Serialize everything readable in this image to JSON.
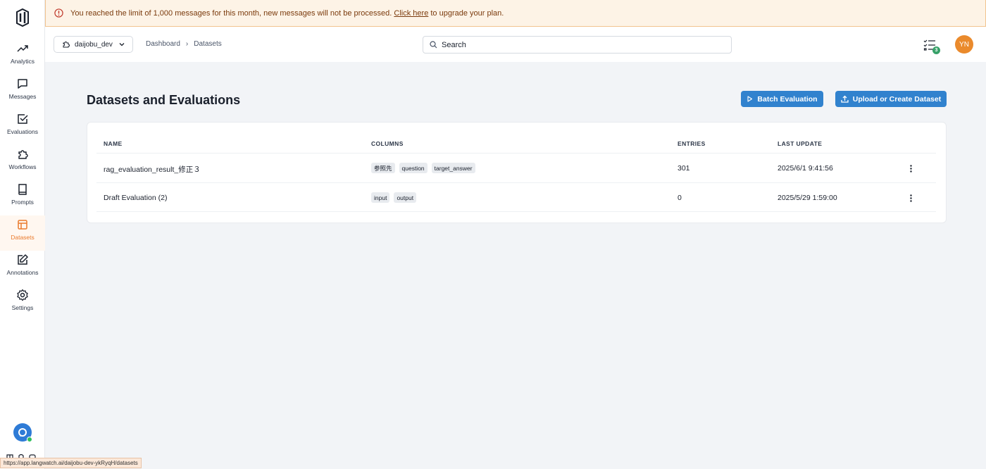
{
  "banner": {
    "text_before": "You reached the limit of 1,000 messages for this month, new messages will not be processed.",
    "link": "Click here",
    "text_after": "to upgrade your plan."
  },
  "sidebar": {
    "items": [
      {
        "label": "Analytics",
        "icon": "trend-up-icon"
      },
      {
        "label": "Messages",
        "icon": "message-icon"
      },
      {
        "label": "Evaluations",
        "icon": "check-square-icon"
      },
      {
        "label": "Workflows",
        "icon": "puzzle-icon"
      },
      {
        "label": "Prompts",
        "icon": "book-icon"
      },
      {
        "label": "Datasets",
        "icon": "table-icon",
        "active": true
      },
      {
        "label": "Annotations",
        "icon": "edit-icon"
      },
      {
        "label": "Settings",
        "icon": "gear-icon"
      }
    ]
  },
  "header": {
    "project": "daijobu_dev",
    "breadcrumb": [
      "Dashboard",
      "Datasets"
    ],
    "search_placeholder": "Search",
    "tasks_count": "3",
    "avatar_initials": "YN"
  },
  "main": {
    "title": "Datasets and Evaluations",
    "batch_button": "Batch Evaluation",
    "upload_button": "Upload or Create Dataset",
    "columns": [
      "NAME",
      "COLUMNS",
      "ENTRIES",
      "LAST UPDATE"
    ],
    "rows": [
      {
        "name": "rag_evaluation_result_修正３",
        "columns": [
          "参照先",
          "question",
          "target_answer"
        ],
        "entries": "301",
        "updated": "2025/6/1 9:41:56"
      },
      {
        "name": "Draft Evaluation (2)",
        "columns": [
          "input",
          "output"
        ],
        "entries": "0",
        "updated": "2025/5/29 1:59:00"
      }
    ]
  },
  "status_url": "https://app.langwatch.ai/daijobu-dev-ykRyqH/datasets",
  "colors": {
    "accent": "#3182ce",
    "active": "#ea7a2c",
    "banner_bg": "#fdf3e6",
    "avatar": "#ea8a2c"
  }
}
